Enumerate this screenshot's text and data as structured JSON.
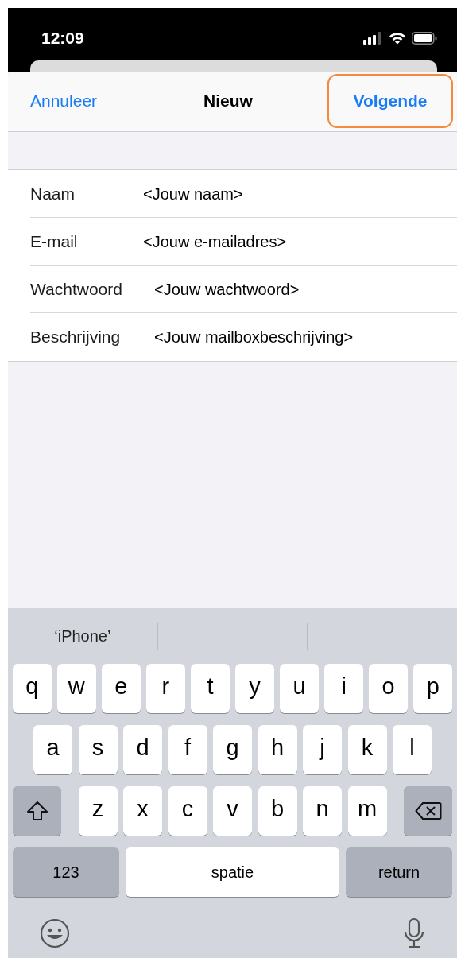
{
  "status_bar": {
    "time": "12:09"
  },
  "nav": {
    "cancel": "Annuleer",
    "title": "Nieuw",
    "next": {
      "label": "Volgende",
      "highlighted": true
    }
  },
  "form": [
    {
      "label": "Naam",
      "value": "<Jouw naam>"
    },
    {
      "label": "E-mail",
      "value": "<Jouw e-mailadres>"
    },
    {
      "label": "Wachtwoord",
      "value": "<Jouw wachtwoord>"
    },
    {
      "label": "Beschrijving",
      "value": "<Jouw mailboxbeschrijving>"
    }
  ],
  "keyboard": {
    "suggestions": [
      "‘iPhone’"
    ],
    "rows": [
      [
        "q",
        "w",
        "e",
        "r",
        "t",
        "y",
        "u",
        "i",
        "o",
        "p"
      ],
      [
        "a",
        "s",
        "d",
        "f",
        "g",
        "h",
        "j",
        "k",
        "l"
      ],
      [
        "z",
        "x",
        "c",
        "v",
        "b",
        "n",
        "m"
      ]
    ],
    "numbers_key": "123",
    "space_key": "spatie",
    "return_key": "return"
  }
}
